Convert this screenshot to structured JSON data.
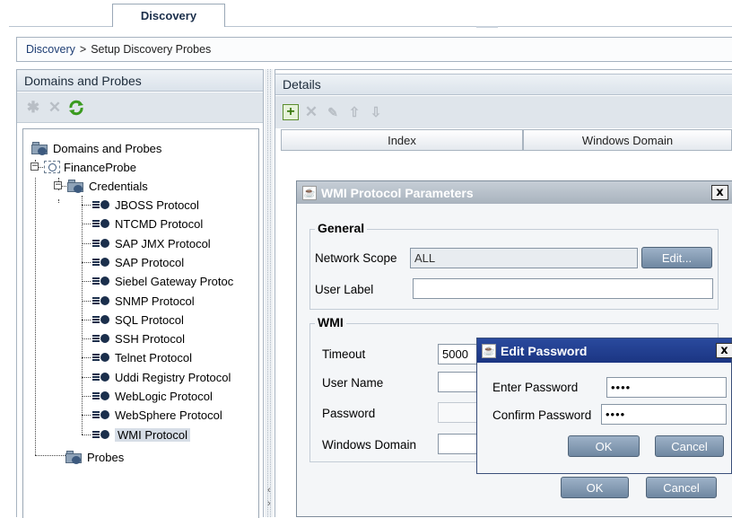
{
  "tabs": {
    "discovery": "Discovery"
  },
  "breadcrumb": {
    "root": "Discovery",
    "separator": ">",
    "current": "Setup Discovery Probes"
  },
  "left_panel": {
    "title": "Domains and Probes",
    "toolbar": [
      "delete-disabled",
      "remove",
      "refresh"
    ],
    "tree": {
      "root": "Domains and Probes",
      "probe": "FinanceProbe",
      "credentials": "Credentials",
      "protocols": [
        "JBOSS Protocol",
        "NTCMD Protocol",
        "SAP JMX Protocol",
        "SAP Protocol",
        "Siebel Gateway Protoc",
        "SNMP Protocol",
        "SQL Protocol",
        "SSH Protocol",
        "Telnet Protocol",
        "Uddi Registry Protocol",
        "WebLogic Protocol",
        "WebSphere Protocol",
        "WMI Protocol"
      ],
      "selected": "WMI Protocol",
      "probes": "Probes"
    }
  },
  "right_panel": {
    "title": "Details",
    "columns": [
      "Index",
      "Windows Domain"
    ]
  },
  "wmi_dialog": {
    "title": "WMI Protocol Parameters",
    "general_title": "General",
    "network_scope_label": "Network Scope",
    "network_scope_value": "ALL",
    "edit_button": "Edit...",
    "user_label_label": "User Label",
    "user_label_value": "",
    "wmi_title": "WMI",
    "timeout_label": "Timeout",
    "timeout_value": "5000",
    "user_name_label": "User Name",
    "password_label": "Password",
    "windows_domain_label": "Windows Domain",
    "ok_button": "OK",
    "cancel_button": "Cancel",
    "close_glyph": "x"
  },
  "password_dialog": {
    "title": "Edit Password",
    "enter_label": "Enter Password",
    "enter_value": "••••",
    "confirm_label": "Confirm Password",
    "confirm_value": "••••",
    "ok_button": "OK",
    "cancel_button": "Cancel",
    "close_glyph": "x"
  }
}
